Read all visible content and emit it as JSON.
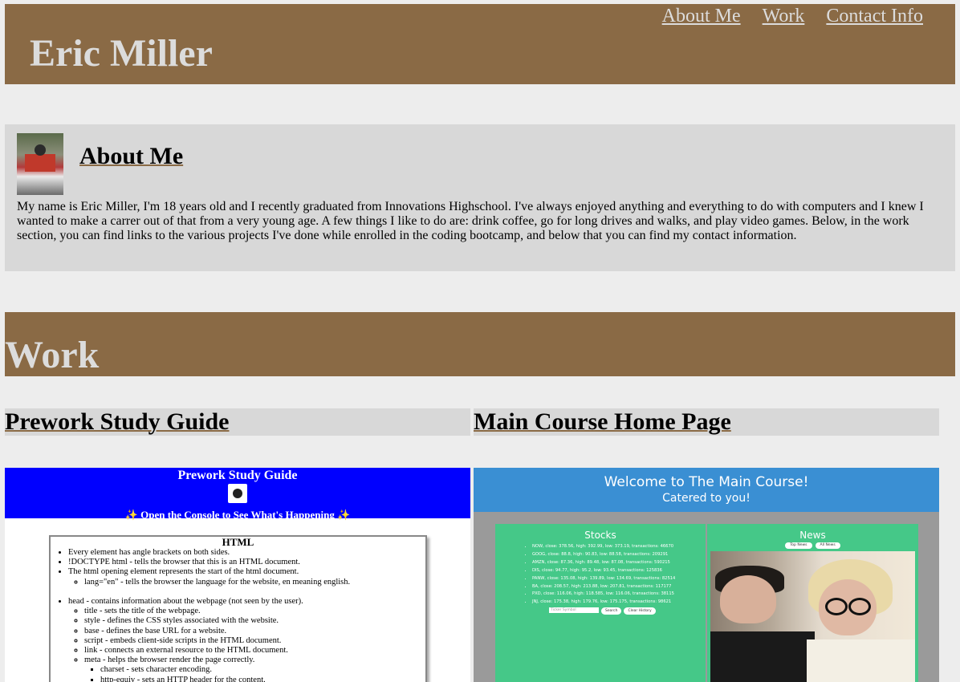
{
  "header": {
    "site_title": "Eric Miller",
    "nav": [
      "About Me",
      "Work",
      "Contact Info"
    ]
  },
  "about": {
    "title": "About Me",
    "avatar_alt": "profile photo",
    "text": "My name is Eric Miller, I'm 18 years old and I recently graduated from Innovations Highschool. I've always enjoyed anything and everything to do with computers and I knew I wanted to make a carrer out of that from a very young age. A few things I like to do are: drink coffee, go for long drives and walks, and play video games. Below, in the work section, you can find links to the various projects I've done while enrolled in the coding bootcamp, and below that you can find my contact information."
  },
  "work": {
    "title": "Work",
    "projects": [
      {
        "title": "Prework Study Guide",
        "screenshot": {
          "header_title": "Prework Study Guide",
          "header_sub": "✨ Open the Console to See What's Happening ✨",
          "box_title": "HTML",
          "items": [
            "Every element has angle brackets on both sides.",
            "!DOCTYPE html - tells the browser that this is an HTML document.",
            "The html opening element represents the start of the html document.",
            "lang=\"en\" - tells the browser the language for the website, en meaning english.",
            "head - contains information about the webpage (not seen by the user).",
            "title - sets the title of the webpage.",
            "style - defines the CSS styles associated with the website.",
            "base - defines the base URL for a website.",
            "script - embeds client-side scripts in the HTML document.",
            "link - connects an external resource to the HTML document.",
            "meta - helps the browser render the page correctly.",
            "charset - sets character encoding.",
            "http-equiv - sets an HTTP header for the content."
          ]
        }
      },
      {
        "title": "Main Course Home Page",
        "screenshot": {
          "header_title": "Welcome to The Main Course!",
          "header_sub": "Catered to you!",
          "stocks_title": "Stocks",
          "stocks": [
            "NOW, close: 378.56, high: 392.99, low: 373.19, transactions: 46670",
            "GOOG, close: 88.8, high: 90.83, low: 88.58, transactions: 209291",
            "AMZN, close: 87.36, high: 89.48, low: 87.08, transactions: 590215",
            "DIS, close: 94.77, high: 95.2, low: 93.45, transactions: 125836",
            "PANW, close: 135.08, high: 139.89, low: 134.69, transactions: 82514",
            "BA, close: 208.57, high: 213.88, low: 207.81, transactions: 117177",
            "PXD, close: 116.06, high: 118.585, low: 116.06, transactions: 38115",
            "JNJ, close: 175.38, high: 179.76, low: 175.175, transactions: 98621"
          ],
          "ticker_placeholder": "Ticker Symbol",
          "search_label": "Search",
          "clear_label": "Clear History",
          "news_title": "News",
          "top_news_label": "Top News",
          "all_news_label": "All News"
        }
      }
    ]
  }
}
